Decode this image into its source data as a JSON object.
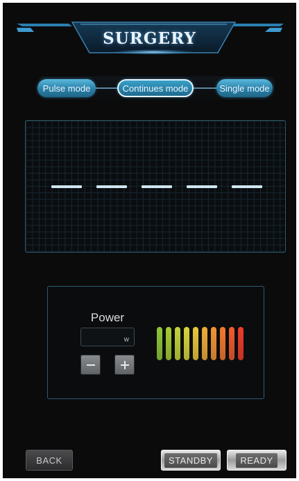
{
  "header": {
    "title": "SURGERY"
  },
  "modes": [
    {
      "label": "Pulse mode",
      "active": false
    },
    {
      "label": "Continues mode",
      "active": true
    },
    {
      "label": "Single mode",
      "active": false
    }
  ],
  "waveform": {
    "pulse_count": 5
  },
  "power": {
    "label": "Power",
    "value": "",
    "unit": "w",
    "decrease_symbol": "−",
    "increase_symbol": "+",
    "level_bar_colors": [
      "#8fc53a",
      "#a3cc35",
      "#c1d43a",
      "#d8d53c",
      "#e8c83c",
      "#efae39",
      "#f29534",
      "#f27930",
      "#f05c2c",
      "#ee3c2a"
    ]
  },
  "footer": {
    "back_label": "BACK",
    "standby_label": "STANDBY",
    "ready_label": "READY"
  },
  "colors": {
    "accent": "#2f8fbd",
    "background": "#0b0b0c",
    "grid_border": "#2c5566"
  }
}
